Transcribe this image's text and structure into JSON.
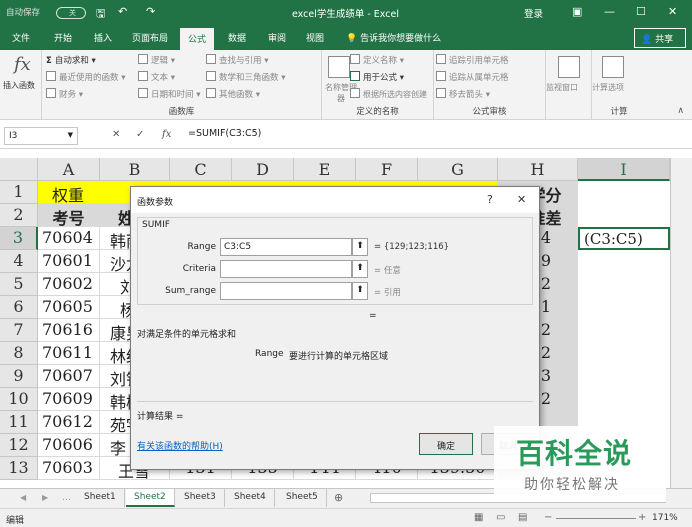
{
  "titlebar": {
    "autosave": "自动保存",
    "autosave_state": "关",
    "title": "excel学生成绩单 - Excel",
    "login": "登录"
  },
  "ribbon_tabs": [
    {
      "label": "文件"
    },
    {
      "label": "开始"
    },
    {
      "label": "插入"
    },
    {
      "label": "页面布局"
    },
    {
      "label": "公式",
      "active": true
    },
    {
      "label": "数据"
    },
    {
      "label": "审阅"
    },
    {
      "label": "视图"
    },
    {
      "label": "告诉我你想要做什么"
    }
  ],
  "share_label": "共享",
  "ribbon": {
    "insert_function": "插入函数",
    "autosum": "自动求和",
    "recent": "最近使用的函数",
    "financial": "财务",
    "logical": "逻辑",
    "text": "文本",
    "datetime": "日期和时间",
    "lookup": "查找与引用",
    "math": "数学和三角函数",
    "more": "其他函数",
    "group_library": "函数库",
    "name_manager": "名称管理器",
    "define_name": "定义名称",
    "use_in_formula": "用于公式",
    "create_from_sel": "根据所选内容创建",
    "group_names": "定义的名称",
    "trace_prec": "追踪引用单元格",
    "trace_dep": "追踪从属单元格",
    "remove_arrows": "移去箭头",
    "group_audit": "公式审核",
    "watch": "监视窗口",
    "calc_options": "计算选项",
    "group_calc": "计算"
  },
  "formula_bar": {
    "name_box": "I3",
    "cancel": "✕",
    "enter": "✓",
    "fx": "fx",
    "formula": "=SUMIF(C3:C5)"
  },
  "columns": [
    "A",
    "B",
    "C",
    "D",
    "E",
    "F",
    "G",
    "H",
    "I"
  ],
  "rows": [
    "1",
    "2",
    "3",
    "4",
    "5",
    "6",
    "7",
    "8",
    "9",
    "10",
    "11",
    "12",
    "13"
  ],
  "cells": {
    "a1": "权重",
    "h1": "总学分",
    "a2": "考号",
    "b2": "姓名",
    "h2": "标准差",
    "col_a": [
      "70604",
      "70601",
      "70602",
      "70605",
      "70616",
      "70611",
      "70607",
      "70609",
      "70612",
      "70606",
      "70603"
    ],
    "col_b": [
      "韩雨",
      "沙龙",
      "刘",
      "杨",
      "康男",
      "林红",
      "刘钦",
      "韩梅",
      "苑宇",
      "李",
      "王雪"
    ],
    "col_h": [
      "4",
      "9",
      "2",
      "1",
      "2",
      "2",
      "3",
      "2",
      "",
      "",
      ""
    ],
    "row13": {
      "c": "131",
      "d": "135",
      "e": "144",
      "f": "410",
      "g": "139.50"
    },
    "i3": "(C3:C5)"
  },
  "dialog": {
    "title": "函数参数",
    "help": "?",
    "close": "✕",
    "function_name": "SUMIF",
    "params": [
      {
        "label": "Range",
        "value": "C3:C5",
        "result": "= {129;123;116}",
        "dim": false
      },
      {
        "label": "Criteria",
        "value": "",
        "result": "= 任意",
        "dim": true
      },
      {
        "label": "Sum_range",
        "value": "",
        "result": "= 引用",
        "dim": true
      }
    ],
    "eq": "=",
    "description": "对满足条件的单元格求和",
    "param_name": "Range",
    "param_desc": "要进行计算的单元格区域",
    "calc_result": "计算结果 =",
    "help_link": "有关该函数的帮助(H)",
    "ok": "确定",
    "cancel": "取消"
  },
  "sheets": [
    "Sheet1",
    "Sheet2",
    "Sheet3",
    "Sheet4",
    "Sheet5"
  ],
  "active_sheet": "Sheet2",
  "status": {
    "mode": "编辑",
    "zoom": "171%"
  },
  "watermark": {
    "main": "百科全说",
    "sub": "助你轻松解决"
  }
}
